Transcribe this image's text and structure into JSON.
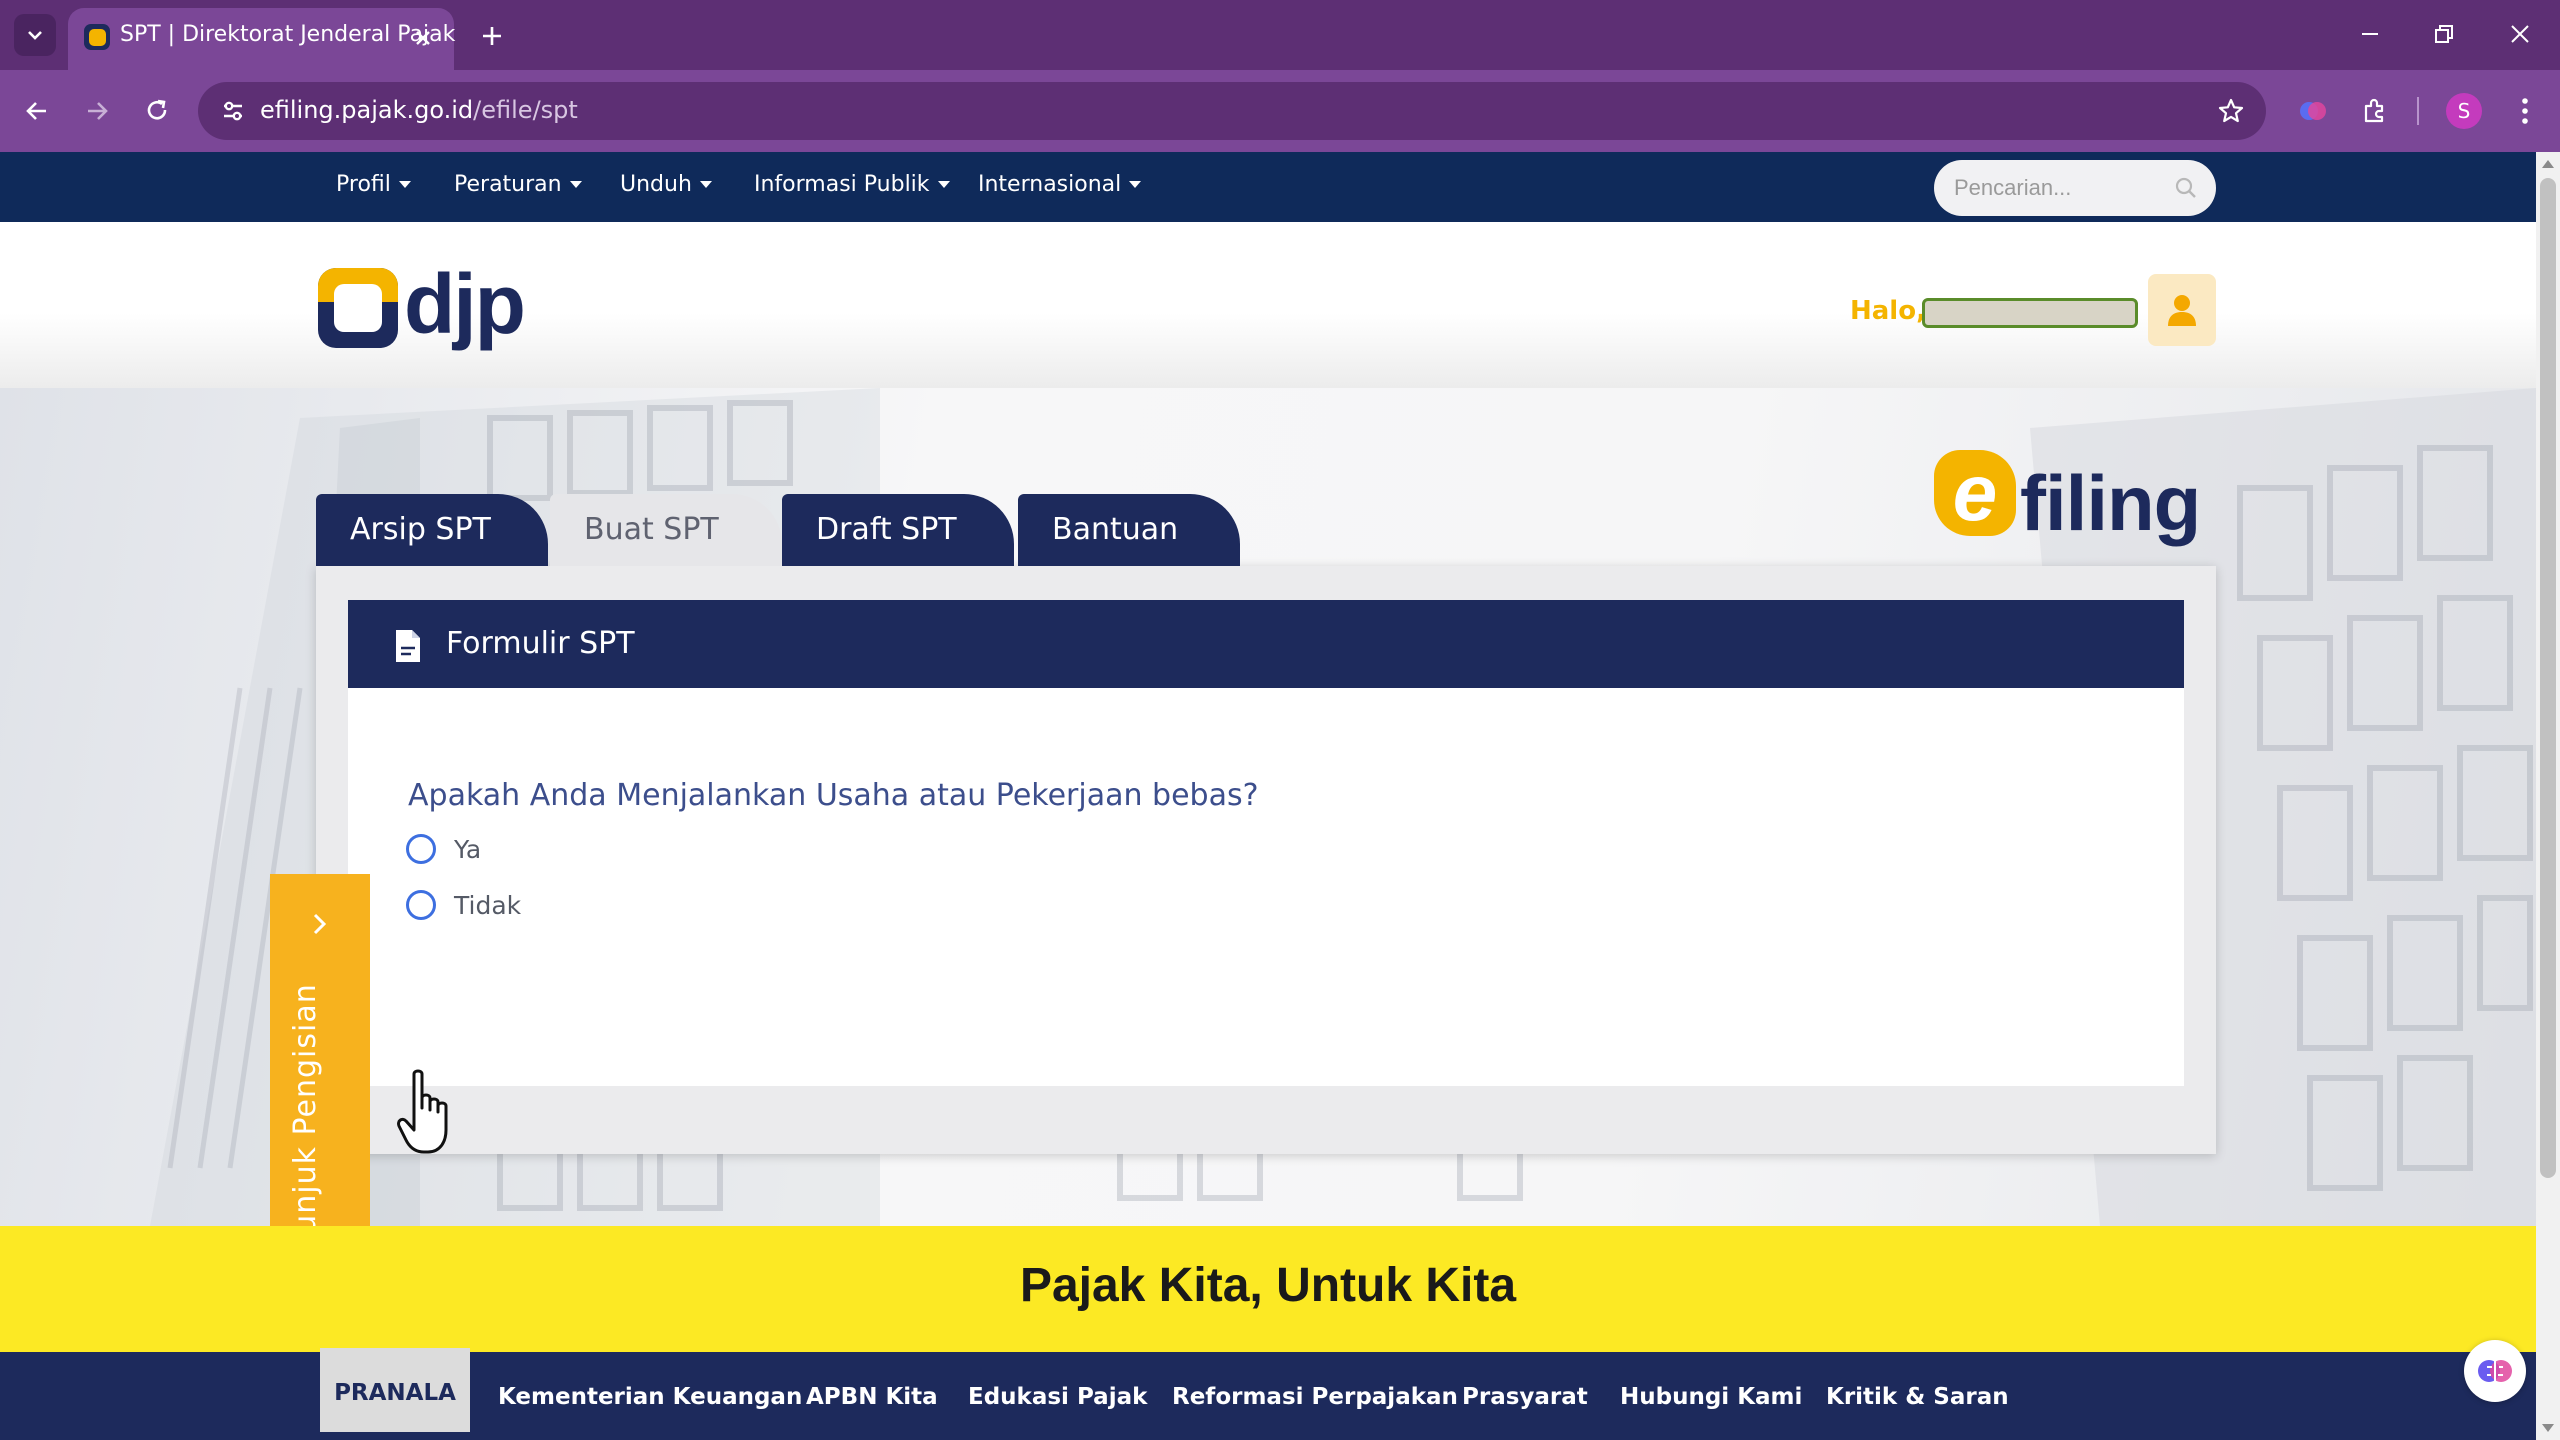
{
  "browser": {
    "tab_title": "SPT | Direktorat Jenderal Pajak",
    "url_domain": "efiling.pajak.go.id",
    "url_path": "/efile/spt",
    "profile_initial": "S",
    "theme_color": "#7b4797"
  },
  "topnav": {
    "items": [
      {
        "label": "Profil"
      },
      {
        "label": "Peraturan"
      },
      {
        "label": "Unduh"
      },
      {
        "label": "Informasi Publik"
      },
      {
        "label": "Internasional"
      }
    ],
    "search_placeholder": "Pencarian..."
  },
  "header": {
    "logo_text": "djp",
    "greeting": "Halo,"
  },
  "efiling_logo": {
    "letter": "e",
    "word": "filing"
  },
  "spt_tabs": [
    {
      "label": "Arsip SPT",
      "state": "dark"
    },
    {
      "label": "Buat SPT",
      "state": "light"
    },
    {
      "label": "Draft SPT",
      "state": "dark"
    },
    {
      "label": "Bantuan",
      "state": "dark"
    }
  ],
  "form": {
    "title": "Formulir SPT",
    "question": "Apakah Anda Menjalankan Usaha atau Pekerjaan bebas?",
    "options": [
      {
        "label": "Ya",
        "selected": false
      },
      {
        "label": "Tidak",
        "selected": false
      }
    ]
  },
  "guide": {
    "label": "Petunjuk Pengisian"
  },
  "slogan": "Pajak Kita, Untuk Kita",
  "footer": {
    "pranala": "PRANALA",
    "links": [
      "Kementerian Keuangan",
      "APBN Kita",
      "Edukasi Pajak",
      "Reformasi Perpajakan",
      "Prasyarat",
      "Hubungi Kami",
      "Kritik & Saran"
    ]
  },
  "colors": {
    "navy": "#1d2a5c",
    "accent_yellow": "#f4b400",
    "guide_orange": "#f7b21e",
    "slogan_yellow": "#fce924"
  }
}
